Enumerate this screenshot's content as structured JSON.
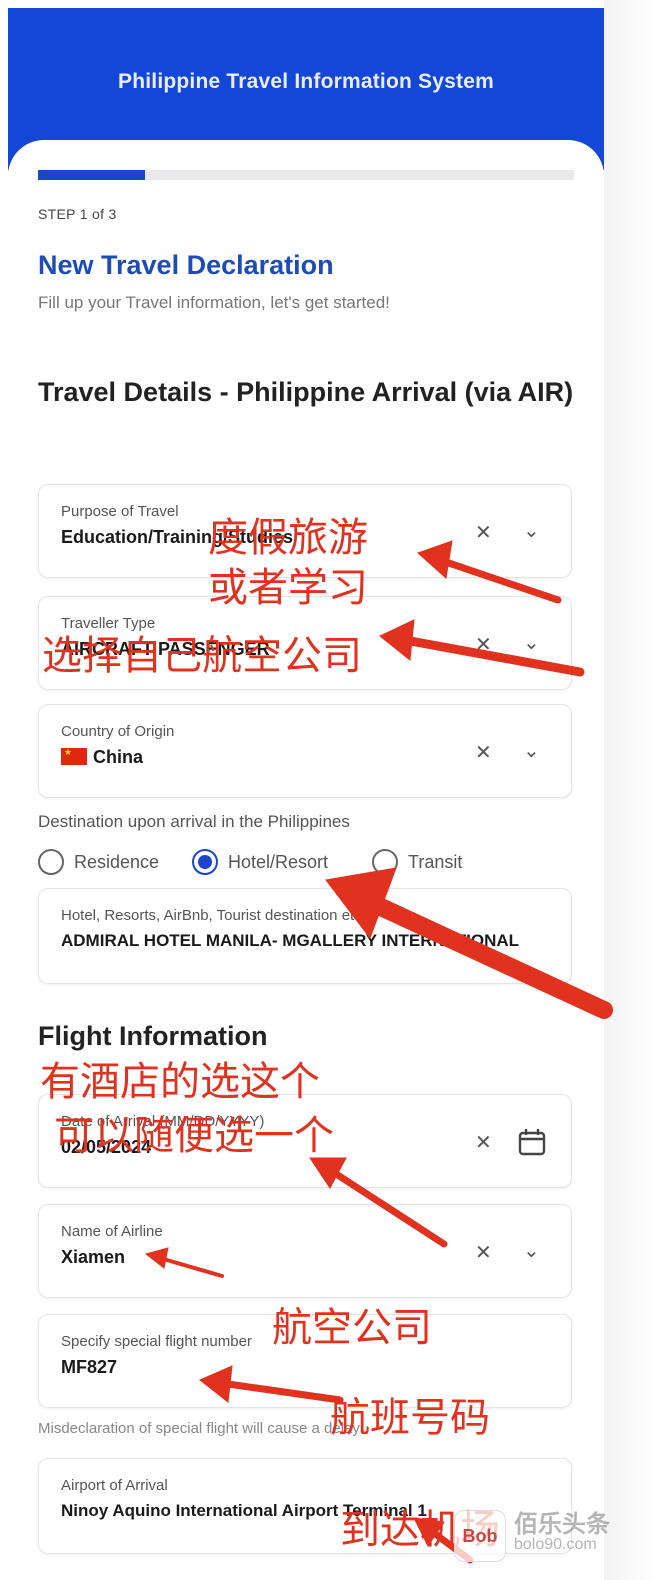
{
  "header": {
    "title": "Philippine Travel Information System"
  },
  "progress": {
    "value": 0.2
  },
  "step_text": "STEP 1 of 3",
  "page_title": "New Travel Declaration",
  "page_subtitle": "Fill up your Travel information, let's get started!",
  "section_travel": "Travel Details - Philippine Arrival (via AIR)",
  "fields": {
    "purpose": {
      "label": "Purpose of Travel",
      "value": "Education/Training/Studies"
    },
    "traveller_type": {
      "label": "Traveller Type",
      "value": "AIRCRAFT PASSENGER"
    },
    "country": {
      "label": "Country of Origin",
      "value": "China"
    },
    "hotel": {
      "label": "Hotel, Resorts, AirBnb, Tourist destination etc.",
      "value": "ADMIRAL HOTEL MANILA- MGALLERY INTERNATIONAL"
    },
    "date": {
      "label": "Date of Arrival (MM/DD/YYYY)",
      "value": "02/05/2024"
    },
    "airline": {
      "label": "Name of Airline",
      "value": "Xiamen"
    },
    "flight": {
      "label": "Specify special flight number",
      "value": "MF827"
    },
    "airport": {
      "label": "Airport of Arrival",
      "value": "Ninoy Aquino International Airport Terminal 1"
    }
  },
  "destination": {
    "label": "Destination upon arrival in the Philippines",
    "options": [
      "Residence",
      "Hotel/Resort",
      "Transit"
    ],
    "selected": "Hotel/Resort"
  },
  "section_flight": "Flight Information",
  "misdeclaration_note": "Misdeclaration of special flight will cause a delay",
  "annotations": {
    "purpose_1": "度假旅游",
    "purpose_2": "或者学习",
    "airline_type": "选择自己航空公司",
    "hotel_1": "有酒店的选这个",
    "hotel_2": "可以随便选一个",
    "airline": "航空公司",
    "flight": "航班号码",
    "airport": "到达机场"
  },
  "watermark": {
    "badge": "Bob",
    "text": "佰乐头条",
    "url": "bolo90.com"
  },
  "icons": {
    "clear": "close-icon",
    "dropdown": "chevron-down-icon",
    "calendar": "calendar-icon",
    "flag": "china-flag-icon"
  },
  "colors": {
    "header": "#1446d8",
    "accent": "#1f4bb8",
    "annotation": "#e0321f"
  }
}
